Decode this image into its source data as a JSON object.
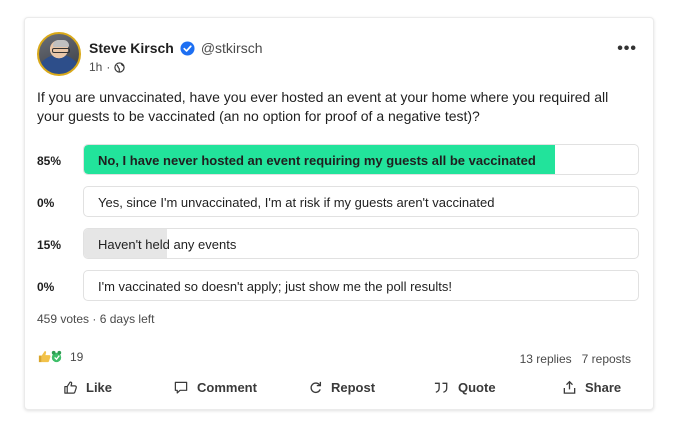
{
  "post": {
    "author": {
      "name": "Steve Kirsch",
      "handle": "@stkirsch",
      "verified": true
    },
    "time": "1h",
    "separator": "·",
    "question": "If you are unvaccinated, have you ever hosted an event at your home where you required all your guests to be vaccinated (an no option for proof of a negative test)?"
  },
  "poll": {
    "options": [
      {
        "percent": "85%",
        "label": "No, I have never hosted an event requiring my guests all be vaccinated",
        "fill": 0.85,
        "selected": true
      },
      {
        "percent": "0%",
        "label": "Yes, since I'm unvaccinated, I'm at risk if my guests aren't vaccinated",
        "fill": 0.0,
        "selected": false
      },
      {
        "percent": "15%",
        "label": "Haven't held any events",
        "fill": 0.15,
        "selected": false
      },
      {
        "percent": "0%",
        "label": "I'm vaccinated so doesn't apply; just show me the poll results!",
        "fill": 0.0,
        "selected": false
      }
    ],
    "votes": "459 votes",
    "time_left": "6 days left",
    "meta_separator": "·"
  },
  "engagement": {
    "reaction_count": "19",
    "replies": "13 replies",
    "reposts": "7 reposts"
  },
  "actions": {
    "like": "Like",
    "comment": "Comment",
    "repost": "Repost",
    "quote": "Quote",
    "share": "Share"
  },
  "colors": {
    "selected_fill": "#22e39b",
    "unselected_fill": "#e6e6e6",
    "verified_blue": "#1d6ff2",
    "avatar_ring": "#d9a91a"
  },
  "icons": [
    "verified-icon",
    "globe-icon",
    "more-options-icon",
    "like-reaction-icon",
    "celebrate-reaction-icon",
    "like-icon",
    "comment-icon",
    "repost-icon",
    "quote-icon",
    "share-icon"
  ]
}
